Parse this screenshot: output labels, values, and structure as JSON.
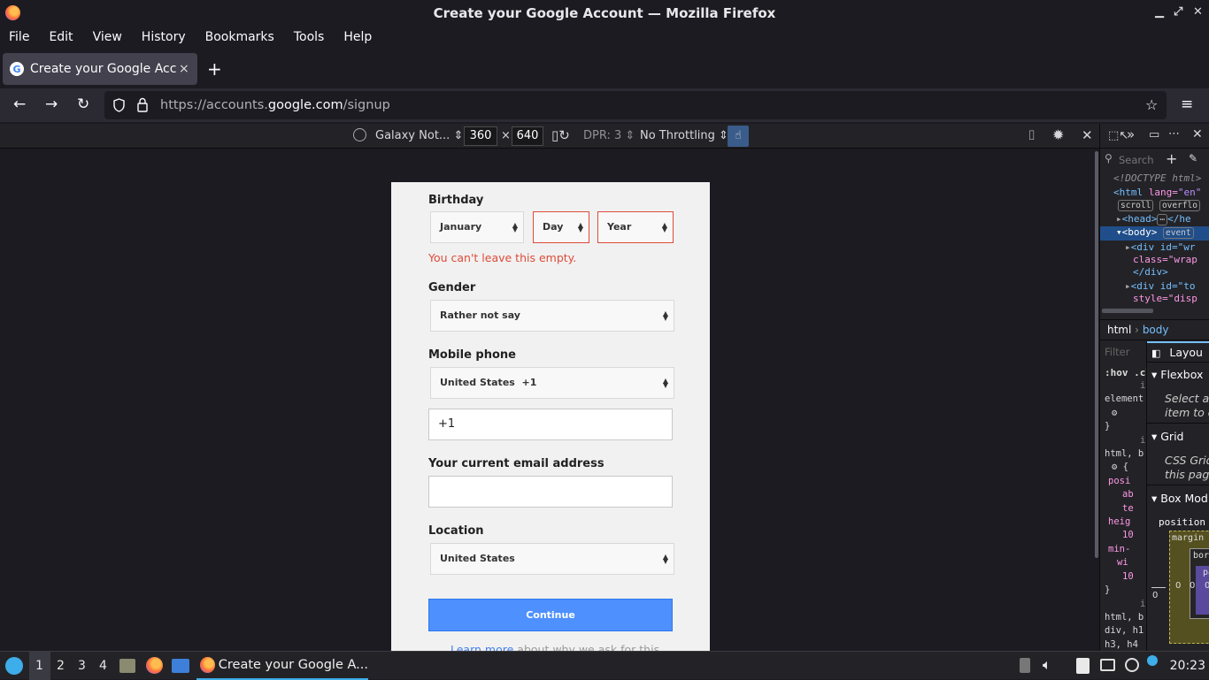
{
  "window": {
    "title": "Create your Google Account — Mozilla Firefox"
  },
  "menu": [
    "File",
    "Edit",
    "View",
    "History",
    "Bookmarks",
    "Tools",
    "Help"
  ],
  "tab": {
    "title": "Create your Google Account",
    "close": "×",
    "new_tab": "+"
  },
  "url": {
    "prefix": "https://accounts.",
    "domain": "google.com",
    "path": "/signup"
  },
  "rdm": {
    "device": "Galaxy Not...",
    "width": "360",
    "times": "×",
    "height": "640",
    "dpr": "DPR: 3",
    "throttling": "No Throttling"
  },
  "form": {
    "birthday_label": "Birthday",
    "month": "January",
    "day": "Day",
    "year": "Year",
    "birthday_error": "You can't leave this empty.",
    "gender_label": "Gender",
    "gender_value": "Rather not say",
    "mobile_label": "Mobile phone",
    "country_code": "United States  +1",
    "phone_value": "+1",
    "email_label": "Your current email address",
    "email_value": "",
    "location_label": "Location",
    "location_value": "United States",
    "continue": "Continue",
    "learn_more_link": "Learn more",
    "learn_more_rest": "about why we ask for this"
  },
  "devtools": {
    "search": "Search",
    "doctype": "<!DOCTYPE html>",
    "html_open": "<html",
    "html_attr": " lang=",
    "html_attr_val": "\"en\"",
    "badge_scroll": "scroll",
    "badge_overflow": "overflo",
    "head": "<head>",
    "head_close": "</he",
    "body": "<body>",
    "badge_event": "event",
    "div1": "<div id=\"wr",
    "div1_class": "class=\"wrap",
    "div1_close": "</div>",
    "div2": "<div id=\"to",
    "div2_style": "style=\"disp",
    "breadcrumb_html": "html",
    "breadcrumb_body": "body",
    "filter": "Filter",
    "hov": ":hov .cl",
    "layout_tab": "Layou",
    "flexbox": "Flexbox",
    "flex_text1": "Select a",
    "flex_text2": "item to c",
    "grid": "Grid",
    "grid_text1": "CSS Grid",
    "grid_text2": "this page",
    "boxmodel": "Box Mod",
    "position": "position",
    "margin": "margin",
    "border": "bord",
    "padding": "pa",
    "zero": "0",
    "rules": [
      "inl",
      "element",
      "}",
      "inl",
      "html, b",
      "{",
      "posi",
      "ab",
      "te",
      "heig",
      "10",
      "min-",
      "wi",
      "10",
      "}",
      "inl",
      "html, b",
      "div, h1",
      "h3, h4"
    ]
  },
  "taskbar": {
    "workspaces": [
      "1",
      "2",
      "3",
      "4"
    ],
    "window_title": "Create your Google A...",
    "clock": "20:23"
  }
}
